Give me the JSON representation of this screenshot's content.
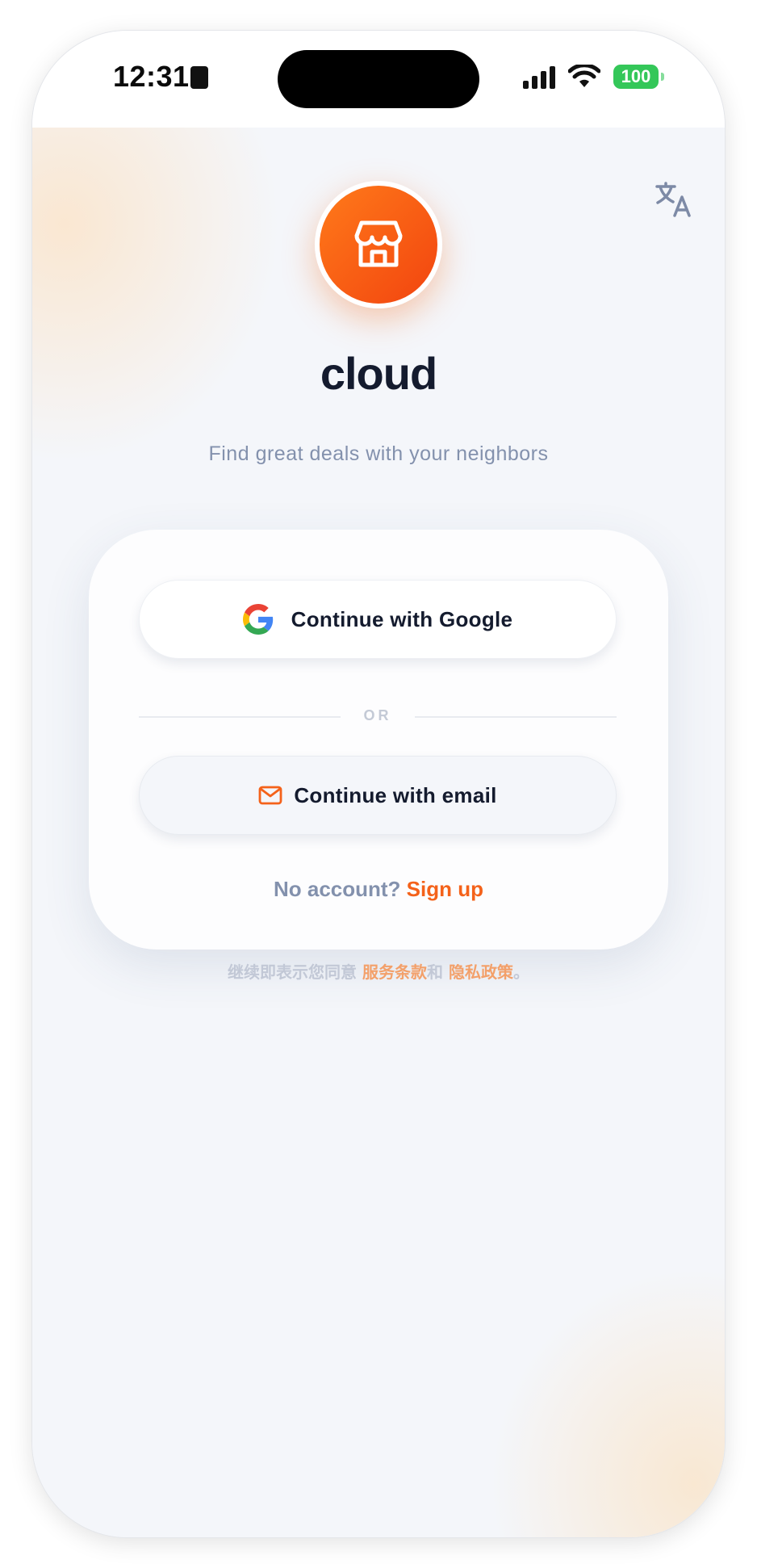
{
  "status_bar": {
    "time": "12:31",
    "battery": "100"
  },
  "header": {
    "translate_icon": "translate-icon"
  },
  "brand": {
    "logo_icon": "storefront-icon",
    "app_name": "cloud",
    "tagline": "Find great deals with your neighbors",
    "accent_color": "#f4621a"
  },
  "auth": {
    "google_label": "Continue with Google",
    "google_icon": "google-icon",
    "divider_text": "OR",
    "email_label": "Continue with email",
    "email_icon": "mail-icon",
    "signup_prefix": "No account?",
    "signup_link": "Sign up"
  },
  "legal": {
    "prefix": "继续即表示您同意",
    "terms": "服务条款",
    "conjunction": "和",
    "privacy": "隐私政策",
    "suffix": "。"
  }
}
